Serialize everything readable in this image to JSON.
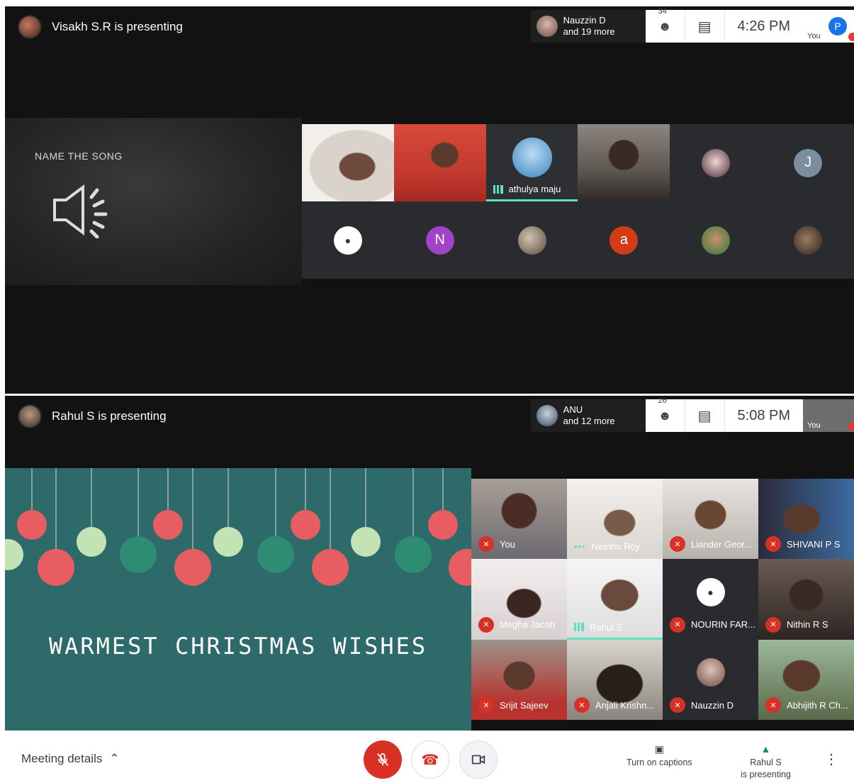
{
  "meeting1": {
    "presenter_text": "Visakh S.R is presenting",
    "pinned_name": "Nauzzin D",
    "pinned_more": "and 19 more",
    "participant_count": "34",
    "time": "4:26 PM",
    "you_label": "You",
    "you_initial": "P",
    "slide_title": "NAME THE SONG",
    "speaker_name": "athulya maju",
    "j_initial": "J",
    "n_initial": "N",
    "a_initial": "a"
  },
  "meeting2": {
    "presenter_text": "Rahul S is presenting",
    "pinned_name": "ANU",
    "pinned_more": "and 12 more",
    "participant_count": "26",
    "time": "5:08 PM",
    "you_label": "You",
    "slide_text": "WARMEST CHRISTMAS WISHES",
    "tiles": [
      "You",
      "Neethu Roy",
      "Liander Geor...",
      "SHIVANI P S",
      "Megha Jacob",
      "Rahul S",
      "NOURIN FAR...",
      "Nithin R S",
      "Srijit Sajeev",
      "Anjali Krishn...",
      "Nauzzin D",
      "Abhijith R Ch..."
    ]
  },
  "bottom": {
    "meeting_details": "Meeting details",
    "captions": "Turn on captions",
    "presenting_line1": "Rahul S",
    "presenting_line2": "is presenting"
  }
}
